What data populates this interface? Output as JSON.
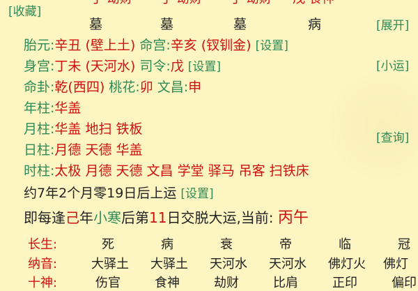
{
  "top": {
    "favorite": "[收藏]",
    "partial_items": [
      {
        "main": "丁",
        "sub": "劫财"
      },
      {
        "main": "丁",
        "sub": "劫财"
      },
      {
        "main": "丁",
        "sub": "劫财"
      },
      {
        "main": "戊",
        "sub": "食神"
      }
    ],
    "stages": [
      "墓",
      "墓",
      "墓",
      "病"
    ]
  },
  "side_buttons": {
    "expand": "[展开]",
    "xiaoyun": "[小运]",
    "query": "[查询]"
  },
  "info": {
    "taiyuan_label": "胎元:",
    "taiyuan_value": "辛丑 (壁上土)",
    "minggong_label": "命宫:",
    "minggong_value": "辛亥 (钗钏金)",
    "settings1": "[设置]",
    "shengong_label": "身宫:",
    "shengong_value": "丁未 (天河水)",
    "siling_label": "司令:",
    "siling_value": "戊",
    "settings2": "[设置]",
    "minggua_label": "命卦:",
    "minggua_value": "乾(西四)",
    "taohua_label": "桃花:",
    "taohua_value": "卯",
    "wenchang_label": "文昌:",
    "wenchang_value": "申",
    "nianzhu_label": "年柱:",
    "nianzhu_value": "华盖",
    "yuezhu_label": "月柱:",
    "yuezhu_value": "华盖 地扫 铁板",
    "rizhu_label": "日柱:",
    "rizhu_value": "月德 天德 华盖",
    "shizhu_label": "时柱:",
    "shizhu_value": "太极 月德 天德 文昌 学堂 驿马 吊客 扫铁床"
  },
  "yun": {
    "start_text": "约7年2个月零19日后上运",
    "settings3": "[设置]",
    "line_p1": "即每逢",
    "line_geng": "己",
    "line_p2": "年",
    "line_xiaohan": "小寒",
    "line_p3": "后第",
    "line_11": "11",
    "line_p4": "日交脱大运,当前: ",
    "current": "丙午"
  },
  "table": {
    "changsheng_label": "长生:",
    "changsheng": [
      "死",
      "病",
      "衰",
      "帝",
      "临",
      "冠"
    ],
    "nayin_label": "纳音:",
    "nayin": [
      "大驿土",
      "大驿土",
      "天河水",
      "天河水",
      "佛灯火",
      "佛灯"
    ],
    "shishen_label": "十神:",
    "shishen": [
      "伤官",
      "食神",
      "劫财",
      "比肩",
      "正印",
      "偏印"
    ]
  }
}
